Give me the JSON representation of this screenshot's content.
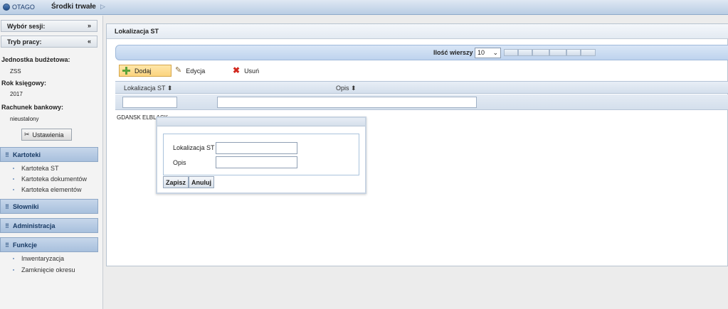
{
  "app": {
    "logo_text": "OTAGO",
    "title": "Środki trwałe"
  },
  "sidebar": {
    "session_label": "Wybór sesji:",
    "mode_label": "Tryb pracy:",
    "unit_label": "Jednostka budżetowa:",
    "unit_value": "ZSS",
    "year_label": "Rok księgowy:",
    "year_value": "2017",
    "account_label": "Rachunek bankowy:",
    "account_value": "nieustalony",
    "settings_button": "Ustawienia",
    "sections": [
      {
        "label": "Kartoteki",
        "items": [
          "Kartoteka ST",
          "Kartoteka dokumentów",
          "Kartoteka elementów"
        ]
      },
      {
        "label": "Słowniki",
        "items": []
      },
      {
        "label": "Administracja",
        "items": []
      },
      {
        "label": "Funkcje",
        "items": [
          "Inwentaryzacja",
          "Zamknięcie okresu"
        ]
      }
    ]
  },
  "main": {
    "panel_title": "Lokalizacja ST",
    "rows_label": "Ilość wierszy",
    "rows_value": "10",
    "toolbar": {
      "add": "Dodaj",
      "edit": "Edycja",
      "delete": "Usuń"
    },
    "columns": [
      "Lokalizacja ST ⬍",
      "Opis ⬍"
    ],
    "row_text": "GDANSK ELBLACK"
  },
  "dialog": {
    "field1_label": "Lokalizacja ST",
    "field2_label": "Opis",
    "save": "Zapisz",
    "cancel": "Anuluj"
  }
}
